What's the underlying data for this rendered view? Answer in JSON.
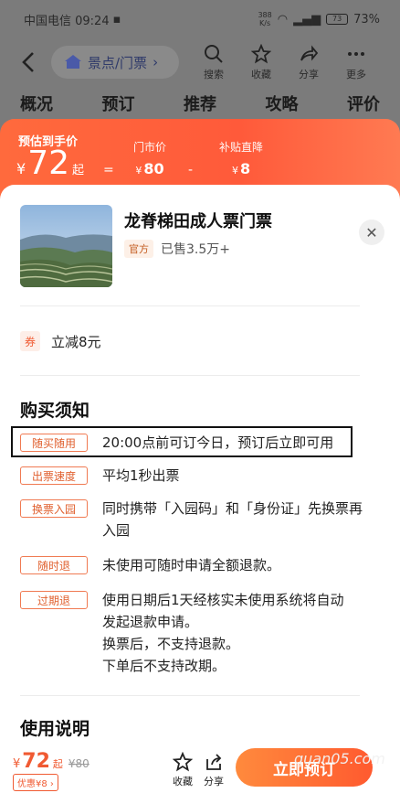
{
  "status_bar": {
    "carrier_time": "中国电信 09:24",
    "net_speed_value": "388",
    "net_speed_unit": "K/s",
    "battery_icon_text": "73",
    "battery_pct": "73%"
  },
  "header": {
    "breadcrumb": "景点/门票",
    "actions": {
      "search": "搜索",
      "favorite": "收藏",
      "share": "分享",
      "more": "更多"
    }
  },
  "tabs": [
    "概况",
    "预订",
    "推荐",
    "攻略",
    "评价"
  ],
  "price_header": {
    "label": "预估到手价",
    "currency": "¥",
    "price": "72",
    "price_suffix": "起",
    "eq": "=",
    "minus": "-",
    "market_label": "门市价",
    "market_value": "80",
    "subsidy_label": "补贴直降",
    "subsidy_value": "8"
  },
  "product": {
    "title": "龙脊梯田成人票门票",
    "tag": "官方",
    "sold": "已售3.5万+"
  },
  "coupon": {
    "badge": "券",
    "text": "立减8元"
  },
  "notice": {
    "title": "购买须知",
    "rules": [
      {
        "tag": "随买随用",
        "lines": [
          "20:00点前可订今日，预订后立即可用"
        ]
      },
      {
        "tag": "出票速度",
        "lines": [
          "平均1秒出票"
        ]
      },
      {
        "tag": "换票入园",
        "lines": [
          "同时携带「入园码」和「身份证」先换票再",
          "入园"
        ]
      },
      {
        "tag": "随时退",
        "lines": [
          "未使用可随时申请全额退款。"
        ]
      },
      {
        "tag": "过期退",
        "lines": [
          "使用日期后1天经核实未使用系统将自动",
          "发起退款申请。",
          "换票后，不支持退款。",
          "下单后不支持改期。"
        ]
      }
    ]
  },
  "usage": {
    "title": "使用说明"
  },
  "bottom_bar": {
    "currency": "¥",
    "price": "72",
    "price_suffix": "起",
    "old_price": "¥80",
    "discount": "优惠¥8",
    "favorite": "收藏",
    "share": "分享",
    "book": "立即预订"
  },
  "watermark": "quan05.com",
  "colors": {
    "accent": "#ff5a3a",
    "tag_border": "#f07a52"
  }
}
